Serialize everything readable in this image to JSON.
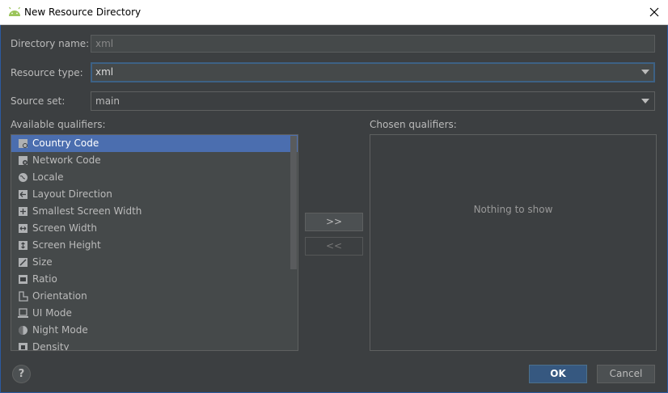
{
  "window": {
    "title": "New Resource Directory",
    "app_icon": "android-icon",
    "close_icon": "close-icon"
  },
  "form": {
    "directory_name": {
      "label": "Directory name:",
      "value": "xml"
    },
    "resource_type": {
      "label": "Resource type:",
      "value": "xml"
    },
    "source_set": {
      "label": "Source set:",
      "value": "main"
    }
  },
  "qualifiers": {
    "available_label": "Available qualifiers:",
    "chosen_label": "Chosen qualifiers:",
    "available": [
      {
        "label": "Country Code",
        "icon": "country-code-icon"
      },
      {
        "label": "Network Code",
        "icon": "network-code-icon"
      },
      {
        "label": "Locale",
        "icon": "globe-icon"
      },
      {
        "label": "Layout Direction",
        "icon": "layout-direction-icon"
      },
      {
        "label": "Smallest Screen Width",
        "icon": "smallest-screen-width-icon"
      },
      {
        "label": "Screen Width",
        "icon": "screen-width-icon"
      },
      {
        "label": "Screen Height",
        "icon": "screen-height-icon"
      },
      {
        "label": "Size",
        "icon": "size-icon"
      },
      {
        "label": "Ratio",
        "icon": "ratio-icon"
      },
      {
        "label": "Orientation",
        "icon": "orientation-icon"
      },
      {
        "label": "UI Mode",
        "icon": "ui-mode-icon"
      },
      {
        "label": "Night Mode",
        "icon": "night-mode-icon"
      },
      {
        "label": "Density",
        "icon": "density-icon"
      }
    ],
    "selected_index": 0,
    "chosen_empty_text": "Nothing to show",
    "add_button": ">>",
    "remove_button": "<<"
  },
  "buttons": {
    "help": "?",
    "ok": "OK",
    "cancel": "Cancel"
  },
  "colors": {
    "background": "#3c3f41",
    "selection": "#4b6eaf",
    "ok_button": "#365880",
    "focus_border": "#3d6185"
  }
}
